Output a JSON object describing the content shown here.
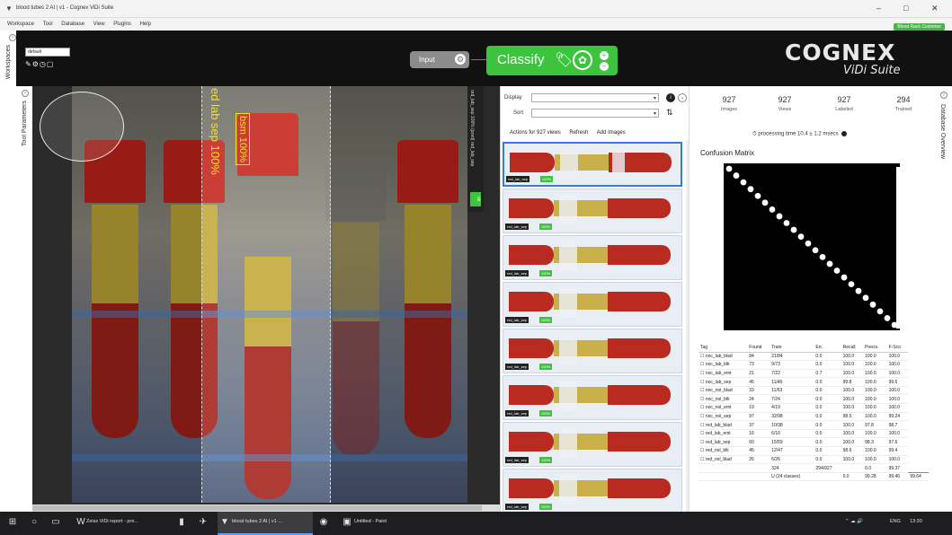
{
  "window": {
    "title": "blood tubes 2 AI | v1 - Cognex ViDi Suite",
    "user_badge": "Blood Rack Customer",
    "minimize": "–",
    "maximize": "□",
    "close": "✕"
  },
  "menu": [
    "Workspace",
    "Tool",
    "Database",
    "View",
    "Plugins",
    "Help"
  ],
  "left_rail": {
    "workspaces": "Workspaces",
    "tool_parameters": "Tool Parameters"
  },
  "right_rail": {
    "database_overview": "Database Overview"
  },
  "toolbar": {
    "stream": "default",
    "input_label": "Input",
    "classify_label": "Classify",
    "brand": "COGNEX",
    "brand_sub": "ViDi Suite"
  },
  "viewer": {
    "overlay_text": "ed lab sep 100%",
    "overlay_text2": "bsm 100%",
    "side_result": "red_lab_sep 100% (pred) red_lab_sep",
    "side_badge": "ok"
  },
  "database": {
    "display_label": "Display",
    "sort_label": "Sort",
    "actions": [
      "Actions for 927 views",
      "Refresh",
      "Add Images"
    ],
    "thumb_tag": "red_lab_sep",
    "thumb_score": "100%"
  },
  "stats": {
    "items": [
      {
        "value": "927",
        "label": "Images"
      },
      {
        "value": "927",
        "label": "Views"
      },
      {
        "value": "927",
        "label": "Labeled"
      },
      {
        "value": "294",
        "label": "Trained"
      }
    ],
    "processing_time": "⏱ processing time 10.4 ± 1.2 msecs",
    "confusion_title": "Confusion Matrix"
  },
  "metrics": {
    "headers": [
      "Tag",
      "Found",
      "Train",
      "Err.",
      "Recall",
      "Precis.",
      "F-Sco"
    ],
    "rows": [
      [
        "noc_lab_blad",
        "84",
        "21/84",
        "0.0",
        "100.0",
        "100.0",
        "100.0"
      ],
      [
        "noc_lab_blk",
        "73",
        "9/73",
        "0.0",
        "100.0",
        "100.0",
        "100.0"
      ],
      [
        "noc_lab_emt",
        "21",
        "7/22",
        "0.7",
        "100.0",
        "100.0",
        "100.0"
      ],
      [
        "noc_lab_sep",
        "45",
        "11/46",
        "0.0",
        "99.8",
        "100.0",
        "99.6"
      ],
      [
        "noc_nol_blad",
        "33",
        "11/53",
        "0.0",
        "100.0",
        "100.0",
        "100.0"
      ],
      [
        "noc_nol_blk",
        "24",
        "7/24",
        "0.0",
        "100.0",
        "100.0",
        "100.0"
      ],
      [
        "noc_nol_emt",
        "19",
        "4/19",
        "0.0",
        "100.0",
        "100.0",
        "100.0"
      ],
      [
        "noc_nol_sep",
        "97",
        "32/98",
        "0.0",
        "98.5",
        "100.0",
        "99.24"
      ],
      [
        "red_lab_blad",
        "37",
        "10/38",
        "0.0",
        "100.0",
        "97.8",
        "98.7"
      ],
      [
        "red_lab_emt",
        "16",
        "6/16",
        "0.0",
        "100.0",
        "100.0",
        "100.0"
      ],
      [
        "red_lab_sep",
        "60",
        "15/59",
        "0.0",
        "100.0",
        "98.3",
        "97.6"
      ],
      [
        "red_nol_blk",
        "45",
        "12/47",
        "0.0",
        "98.6",
        "100.0",
        "99.4"
      ],
      [
        "red_nol_blad",
        "26",
        "6/26",
        "0.0",
        "100.0",
        "100.0",
        "100.0"
      ]
    ],
    "footer": [
      [
        "",
        "",
        "324",
        "294/927",
        "",
        "0.0",
        "99.37"
      ],
      [
        "",
        "",
        "U (24 classes)",
        "",
        "0.0",
        "99.28",
        "99.46",
        "99.64"
      ]
    ]
  },
  "taskbar": {
    "items": [
      "Zeiss ViDi report - pre...",
      "blood tubes 2 AI | v1 ...",
      "Untitled - Paint"
    ],
    "lang": "ENG",
    "time": "13:30",
    "tray": "⌃  ☁  🔊"
  }
}
